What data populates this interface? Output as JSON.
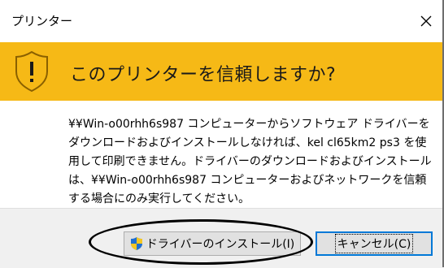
{
  "window": {
    "title": "プリンター"
  },
  "banner": {
    "heading": "このプリンターを信頼しますか?",
    "color": "#f6b916"
  },
  "message": {
    "lines": [
      "¥¥Win-o00rhh6s987 コンピューターからソフトウェア ドライバーを",
      "ダウンロードおよびインストールしなければ、kel cl65km2 ps3 を使",
      "用して印刷できません。ドライバーのダウンロードおよびインストール",
      "は、¥¥Win-o00rhh6s987 コンピューターおよびネットワークを信頼",
      "する場合にのみ実行してください。"
    ]
  },
  "buttons": {
    "install_label": "ドライバーのインストール(I)",
    "cancel_label": "キャンセル(C)"
  },
  "icons": {
    "warning": "shield-warning-icon",
    "uac": "uac-shield-icon",
    "close": "close-icon"
  },
  "accent_color": "#0078d7"
}
